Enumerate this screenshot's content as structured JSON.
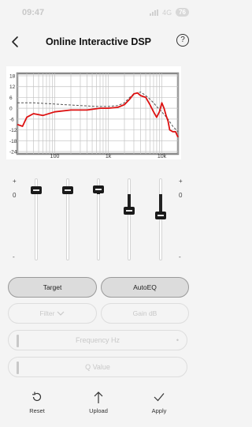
{
  "status_bar": {
    "time": "09:47",
    "network": "4G",
    "battery": "76"
  },
  "header": {
    "title": "Online Interactive DSP"
  },
  "chart_data": {
    "type": "line",
    "xscale": "log",
    "xlim": [
      20,
      20000
    ],
    "ylim": [
      -24,
      18
    ],
    "y_ticks": [
      "18",
      "12",
      "6",
      "0",
      "-6",
      "-12",
      "-18",
      "-24"
    ],
    "x_ticks": [
      "100",
      "1k",
      "10k"
    ],
    "grid": true,
    "series": [
      {
        "style": "dashed",
        "color": "#555555",
        "x": [
          20,
          40,
          80,
          150,
          300,
          600,
          1000,
          1500,
          2000,
          2500,
          3000,
          4000,
          5000,
          6000,
          7000,
          8000,
          10000,
          13000,
          16000,
          20000
        ],
        "y": [
          3,
          3,
          2.5,
          2,
          1.5,
          1,
          1,
          1.5,
          3,
          6,
          8,
          9,
          7,
          5,
          3,
          1,
          -2,
          -6,
          -10,
          -13
        ]
      },
      {
        "style": "solid",
        "color": "#dd1010",
        "x": [
          20,
          25,
          30,
          40,
          60,
          100,
          200,
          400,
          700,
          1000,
          1500,
          2000,
          2500,
          3000,
          3500,
          4000,
          5000,
          6000,
          7000,
          8000,
          9000,
          10000,
          11000,
          12000,
          13000,
          14000,
          16000,
          18000,
          20000
        ],
        "y": [
          -9,
          -10,
          -5,
          -3,
          -4,
          -2,
          -1,
          -1,
          0,
          0,
          0.5,
          2,
          5,
          8,
          8.5,
          7,
          6,
          2,
          -2,
          -5,
          -2,
          3,
          0,
          -4,
          -7,
          -12,
          -13,
          -13,
          -16
        ]
      }
    ]
  },
  "sliders": {
    "plus": "+",
    "zero": "0",
    "minus": "-",
    "bands": [
      {
        "value": 0.5
      },
      {
        "value": 0.5
      },
      {
        "value": 0.6
      },
      {
        "value": -2.0
      },
      {
        "value": -2.6
      }
    ]
  },
  "buttons": {
    "target": "Target",
    "autoeq": "AutoEQ",
    "filter": "Filter",
    "gain": "Gain  dB"
  },
  "fields": {
    "frequency": "Frequency  Hz",
    "frequency_dot": "•",
    "q_value": "Q Value"
  },
  "bottom": {
    "reset": "Reset",
    "upload": "Upload",
    "apply": "Apply"
  }
}
